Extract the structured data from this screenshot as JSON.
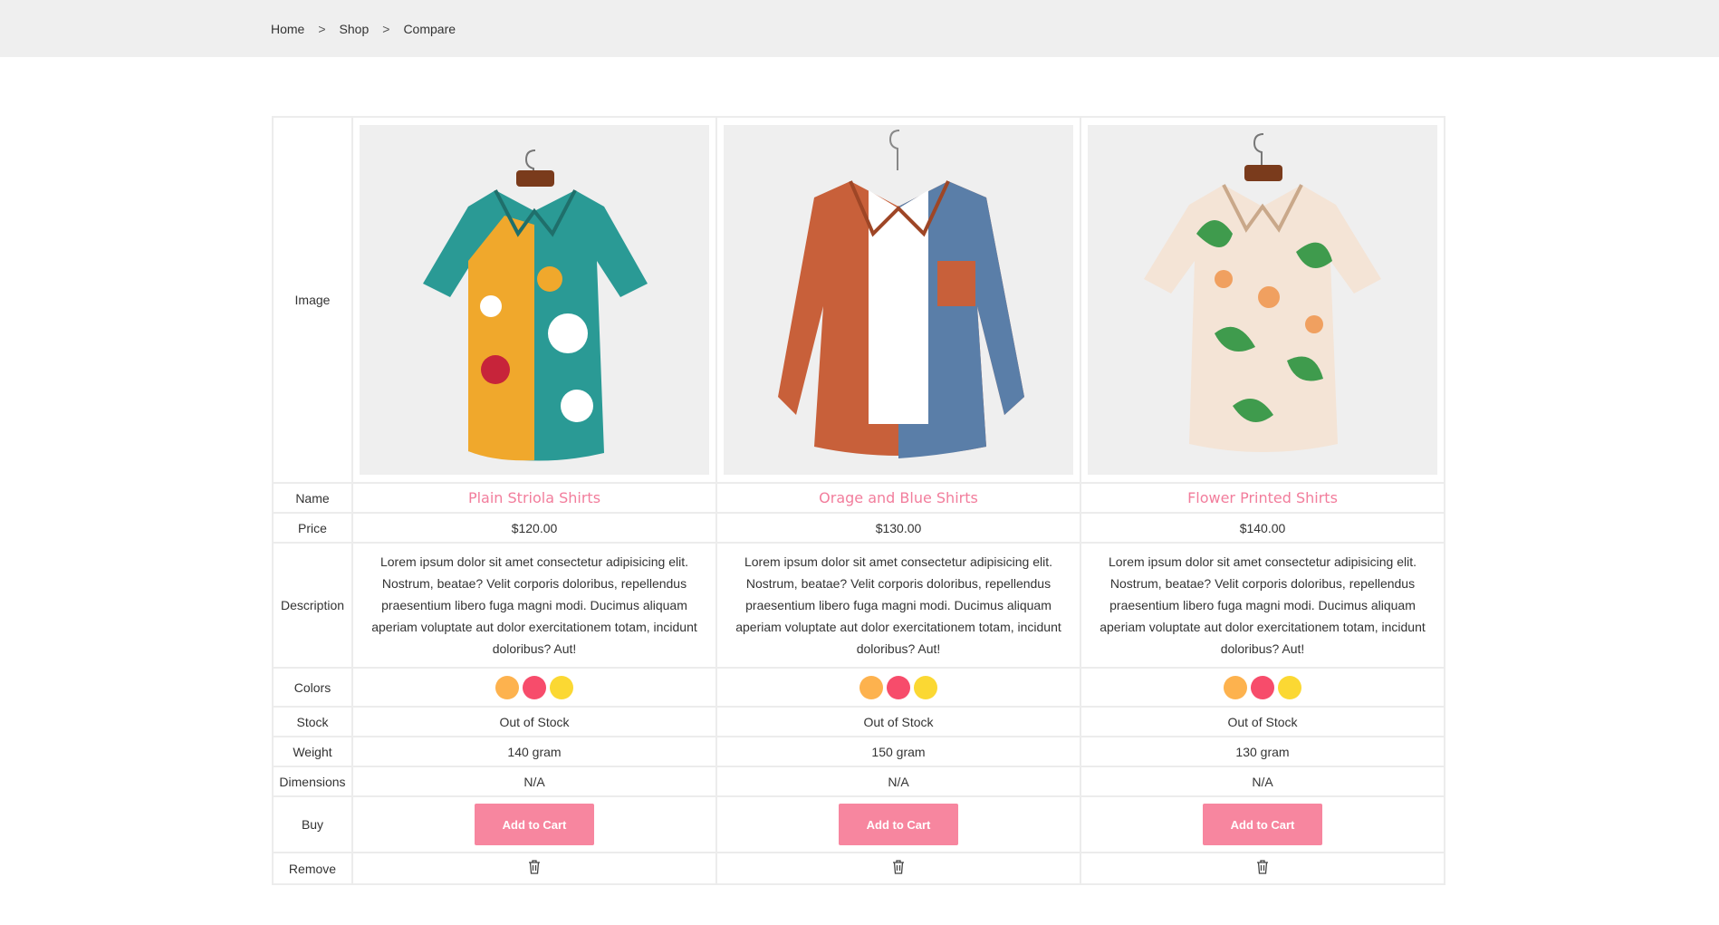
{
  "breadcrumb": [
    "Home",
    "Shop",
    "Compare"
  ],
  "breadcrumb_sep": ">",
  "row_labels": {
    "image": "Image",
    "name": "Name",
    "price": "Price",
    "description": "Description",
    "colors": "Colors",
    "stock": "Stock",
    "weight": "Weight",
    "dimensions": "Dimensions",
    "buy": "Buy",
    "remove": "Remove"
  },
  "swatch_colors": [
    "#fdb24e",
    "#f74c6b",
    "#fbd833"
  ],
  "products": [
    {
      "name": "Plain Striola Shirts",
      "price": "$120.00",
      "description": "Lorem ipsum dolor sit amet consectetur adipisicing elit. Nostrum, beatae? Velit corporis doloribus, repellendus praesentium libero fuga magni modi. Ducimus aliquam aperiam voluptate aut dolor exercitationem totam, incidunt doloribus? Aut!",
      "stock": "Out of Stock",
      "weight": "140 gram",
      "dimensions": "N/A",
      "buy_label": "Add to Cart",
      "image_icon": "patterned-shirt"
    },
    {
      "name": "Orage and Blue Shirts",
      "price": "$130.00",
      "description": "Lorem ipsum dolor sit amet consectetur adipisicing elit. Nostrum, beatae? Velit corporis doloribus, repellendus praesentium libero fuga magni modi. Ducimus aliquam aperiam voluptate aut dolor exercitationem totam, incidunt doloribus? Aut!",
      "stock": "Out of Stock",
      "weight": "150 gram",
      "dimensions": "N/A",
      "buy_label": "Add to Cart",
      "image_icon": "two-tone-shirt"
    },
    {
      "name": "Flower Printed Shirts",
      "price": "$140.00",
      "description": "Lorem ipsum dolor sit amet consectetur adipisicing elit. Nostrum, beatae? Velit corporis doloribus, repellendus praesentium libero fuga magni modi. Ducimus aliquam aperiam voluptate aut dolor exercitationem totam, incidunt doloribus? Aut!",
      "stock": "Out of Stock",
      "weight": "130 gram",
      "dimensions": "N/A",
      "buy_label": "Add to Cart",
      "image_icon": "floral-shirt"
    }
  ]
}
